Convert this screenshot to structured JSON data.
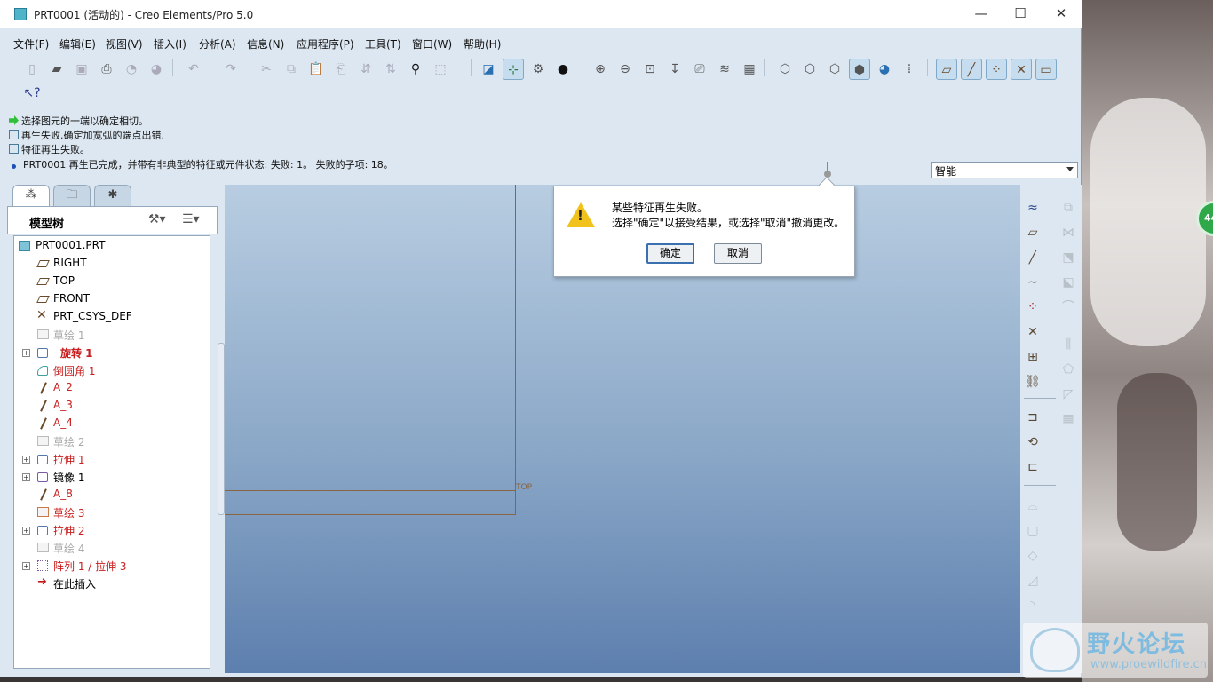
{
  "window": {
    "title": "PRT0001 (活动的) - Creo Elements/Pro 5.0",
    "minimize": "—",
    "maximize": "☐",
    "close": "✕"
  },
  "menu": [
    "文件(F)",
    "编辑(E)",
    "视图(V)",
    "插入(I)",
    "分析(A)",
    "信息(N)",
    "应用程序(P)",
    "工具(T)",
    "窗口(W)",
    "帮助(H)"
  ],
  "messages": [
    {
      "icon": "green-arrow-icon",
      "text": "选择图元的一端以确定相切。"
    },
    {
      "icon": "message-box-icon",
      "text": "再生失败.确定加宽弧的端点出错."
    },
    {
      "icon": "message-box-icon",
      "text": "特征再生失败。"
    },
    {
      "icon": "bullet-icon",
      "text": "PRT0001 再生已完成，并带有非典型的特征或元件状态: 失败: 1。 失败的子项: 18。"
    }
  ],
  "filter": {
    "value": "智能"
  },
  "model_tree": {
    "title": "模型树",
    "items": [
      {
        "label": "PRT0001.PRT",
        "icon": "part-icon",
        "style": "normal"
      },
      {
        "label": "RIGHT",
        "icon": "datum-plane-icon",
        "style": "normal"
      },
      {
        "label": "TOP",
        "icon": "datum-plane-icon",
        "style": "normal"
      },
      {
        "label": "FRONT",
        "icon": "datum-plane-icon",
        "style": "normal"
      },
      {
        "label": "PRT_CSYS_DEF",
        "icon": "csys-icon",
        "style": "normal"
      },
      {
        "label": "草绘 1",
        "icon": "sketch-icon",
        "style": "grey"
      },
      {
        "label": "旋转 1",
        "icon": "revolve-icon",
        "style": "red-bold"
      },
      {
        "label": "倒圆角 1",
        "icon": "round-icon",
        "style": "red"
      },
      {
        "label": "A_2",
        "icon": "datum-axis-icon",
        "style": "red"
      },
      {
        "label": "A_3",
        "icon": "datum-axis-icon",
        "style": "red"
      },
      {
        "label": "A_4",
        "icon": "datum-axis-icon",
        "style": "red"
      },
      {
        "label": "草绘 2",
        "icon": "sketch-icon",
        "style": "grey"
      },
      {
        "label": "拉伸 1",
        "icon": "extrude-icon",
        "style": "red"
      },
      {
        "label": "镜像 1",
        "icon": "mirror-icon",
        "style": "normal"
      },
      {
        "label": "A_8",
        "icon": "datum-axis-icon",
        "style": "red"
      },
      {
        "label": "草绘 3",
        "icon": "sketch-icon",
        "style": "red"
      },
      {
        "label": "拉伸 2",
        "icon": "extrude-icon",
        "style": "red"
      },
      {
        "label": "草绘 4",
        "icon": "sketch-icon",
        "style": "grey"
      },
      {
        "label": "阵列 1 / 拉伸 3",
        "icon": "pattern-icon",
        "style": "red"
      },
      {
        "label": "在此插入",
        "icon": "insert-here-icon",
        "style": "normal"
      }
    ]
  },
  "graphics": {
    "plane_label": "TOP"
  },
  "dialog": {
    "line1": "某些特征再生失败。",
    "line2": "选择\"确定\"以接受结果，或选择\"取消\"撤消更改。",
    "ok": "确定",
    "cancel": "取消"
  },
  "watermark": {
    "title": "野火论坛",
    "url": "www.proewildfire.cn"
  },
  "badge": {
    "text": "44"
  }
}
